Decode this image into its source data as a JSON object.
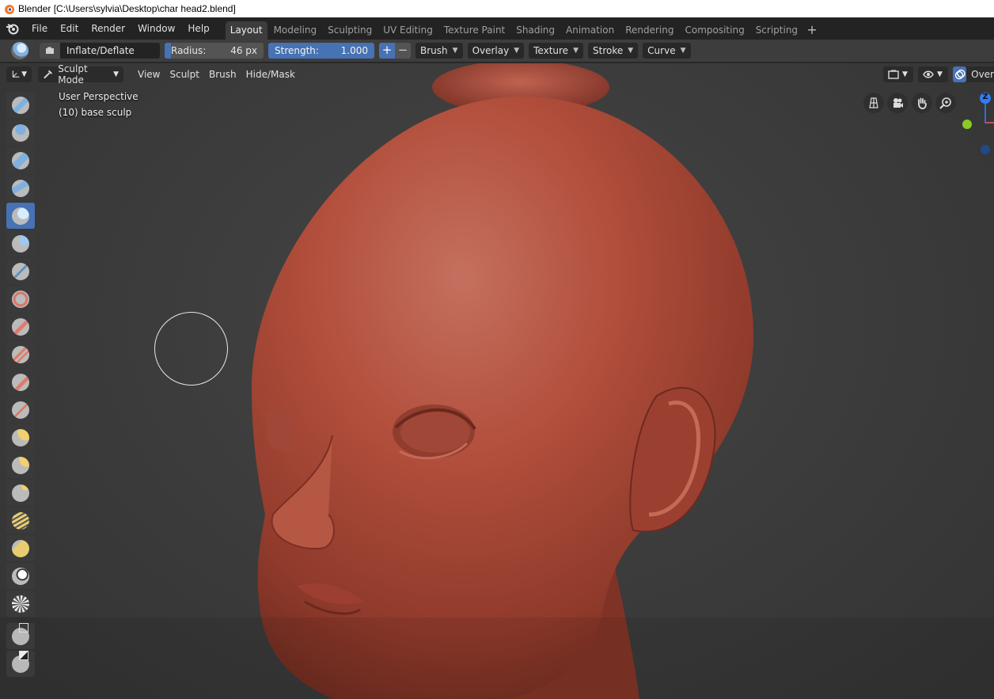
{
  "window": {
    "title": "Blender [C:\\Users\\sylvia\\Desktop\\char head2.blend]"
  },
  "menubar": {
    "items": [
      "File",
      "Edit",
      "Render",
      "Window",
      "Help"
    ],
    "workspace_tabs": [
      "Layout",
      "Modeling",
      "Sculpting",
      "UV Editing",
      "Texture Paint",
      "Shading",
      "Animation",
      "Rendering",
      "Compositing",
      "Scripting"
    ],
    "active_tab": "Layout",
    "add_tab_label": "+"
  },
  "toolheader": {
    "brush_name": "Inflate/Deflate",
    "radius_label": "Radius:",
    "radius_value": "46 px",
    "strength_label": "Strength:",
    "strength_value": "1.000",
    "plus_label": "+",
    "minus_label": "−",
    "dropdowns": [
      "Brush",
      "Overlay",
      "Texture",
      "Stroke",
      "Curve"
    ]
  },
  "viewport": {
    "mode_label": "Sculpt Mode",
    "menus": [
      "View",
      "Sculpt",
      "Brush",
      "Hide/Mask"
    ],
    "perspective_label": "User Perspective",
    "object_label": "(10) base sculp",
    "overlay_label": "Over",
    "gizmo_axis_label": "Z"
  },
  "colors": {
    "accent": "#4772b3",
    "skin": "#b8503f",
    "axis_z": "#2f7cf6",
    "axis_y": "#8ac926"
  },
  "icons": {
    "toolbar_tools": [
      "draw-icon",
      "draw-sharp-icon",
      "clay-icon",
      "clay-strips-icon",
      "inflate-icon",
      "blob-icon",
      "crease-icon",
      "smooth-icon",
      "flatten-icon",
      "fill-icon",
      "scrape-icon",
      "multiplane-scrape-icon",
      "pinch-icon",
      "grab-icon",
      "elastic-deform-icon",
      "snake-hook-icon",
      "thumb-icon",
      "pose-icon",
      "nudge-icon",
      "rotate-icon",
      "slide-relax-icon",
      "mask-icon",
      "box-mask-icon"
    ]
  }
}
